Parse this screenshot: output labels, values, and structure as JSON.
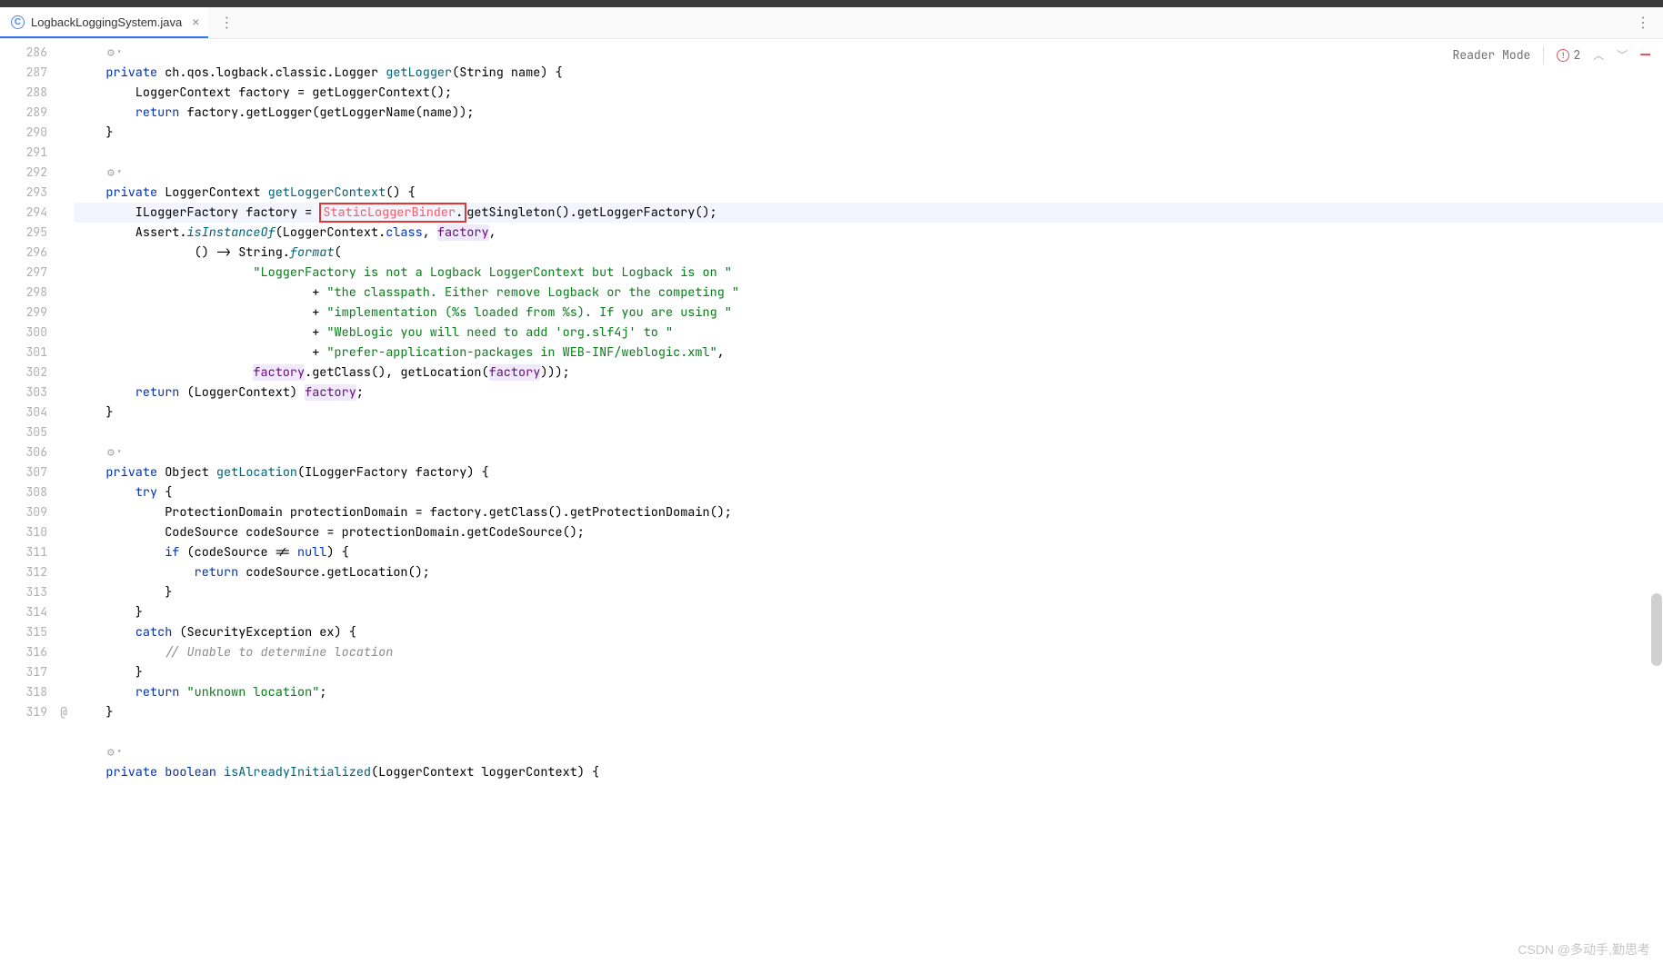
{
  "tab": {
    "filename": "LogbackLoggingSystem.java",
    "icon_letter": "C"
  },
  "toolbar": {
    "reader_mode": "Reader Mode",
    "error_count": "2"
  },
  "watermark": "CSDN @多动手,勤思考",
  "gutter": {
    "start": 286,
    "end": 319,
    "at_lines": [
      319
    ]
  },
  "code_tokens": {
    "kw_private": "private",
    "kw_return": "return",
    "kw_class": "class",
    "kw_try": "try",
    "kw_catch": "catch",
    "kw_if": "if",
    "kw_null": "null",
    "kw_boolean": "boolean",
    "type_Logger": "ch.qos.logback.classic.Logger",
    "type_LoggerContext": "LoggerContext",
    "type_ILoggerFactory": "ILoggerFactory",
    "type_Object": "Object",
    "type_ProtectionDomain": "ProtectionDomain",
    "type_CodeSource": "CodeSource",
    "type_SecurityException": "SecurityException",
    "type_String": "String",
    "fn_getLogger": "getLogger",
    "fn_getLoggerContext": "getLoggerContext",
    "fn_getLoggerName": "getLoggerName",
    "fn_getSingleton": "getSingleton",
    "fn_getLoggerFactory": "getLoggerFactory",
    "fn_isInstanceOf": "isInstanceOf",
    "fn_format": "format",
    "fn_getClass": "getClass",
    "fn_getLocation": "getLocation",
    "fn_getProtectionDomain": "getProtectionDomain",
    "fn_getCodeSource": "getCodeSource",
    "fn_isAlreadyInitialized": "isAlreadyInitialized",
    "id_StaticLoggerBinder": "StaticLoggerBinder",
    "id_Assert": "Assert",
    "id_factory": "factory",
    "id_name": "name",
    "id_protectionDomain": "protectionDomain",
    "id_codeSource": "codeSource",
    "id_ex": "ex",
    "id_loggerContext": "loggerContext",
    "str_line1": "\"LoggerFactory is not a Logback LoggerContext but Logback is on \"",
    "str_line2": "\"the classpath. Either remove Logback or the competing \"",
    "str_line3": "\"implementation (%s loaded from %s). If you are using \"",
    "str_line4": "\"WebLogic you will need to add 'org.slf4j' to \"",
    "str_line5": "\"prefer-application-packages in WEB-INF/weblogic.xml\"",
    "str_unknown": "\"unknown location\"",
    "comment_unable": "// Unable to determine location"
  }
}
